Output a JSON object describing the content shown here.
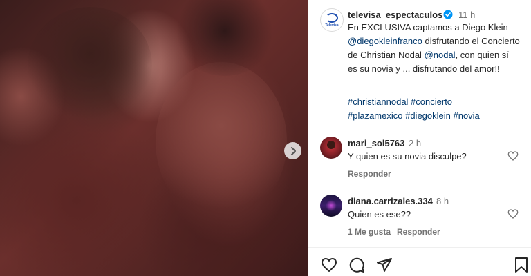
{
  "post": {
    "username": "televisa_espectaculos",
    "time": "11 h",
    "caption_part1": "En EXCLUSIVA captamos a Diego Klein",
    "mention_1": "@diegokleinfranco",
    "caption_part2": " disfrutando el Concierto de Christian Nodal ",
    "mention_2": "@nodal",
    "caption_part3": ", con quien sí es su novia y ... disfrutando del amor!!",
    "hashtags_line1": "#christiannodal #concierto",
    "hashtags_line2": "#plazamexico #diegoklein #novia",
    "avatar_logo_text": "Televisa"
  },
  "comments": [
    {
      "username": "mari_sol5763",
      "time": "2 h",
      "text": "Y quien es su novia disculpe?",
      "reply": "Responder",
      "likes": ""
    },
    {
      "username": "diana.carrizales.334",
      "time": "8 h",
      "text": "Quien es ese??",
      "likes": "1 Me gusta",
      "reply": "Responder"
    }
  ],
  "icons": {
    "verified": "verified-badge-icon",
    "next": "chevron-right-icon",
    "like": "heart-icon",
    "comment": "comment-bubble-icon",
    "share": "paper-plane-icon",
    "save": "bookmark-icon"
  },
  "colors": {
    "link": "#00376b",
    "verified": "#0095f6",
    "muted": "#737373"
  }
}
